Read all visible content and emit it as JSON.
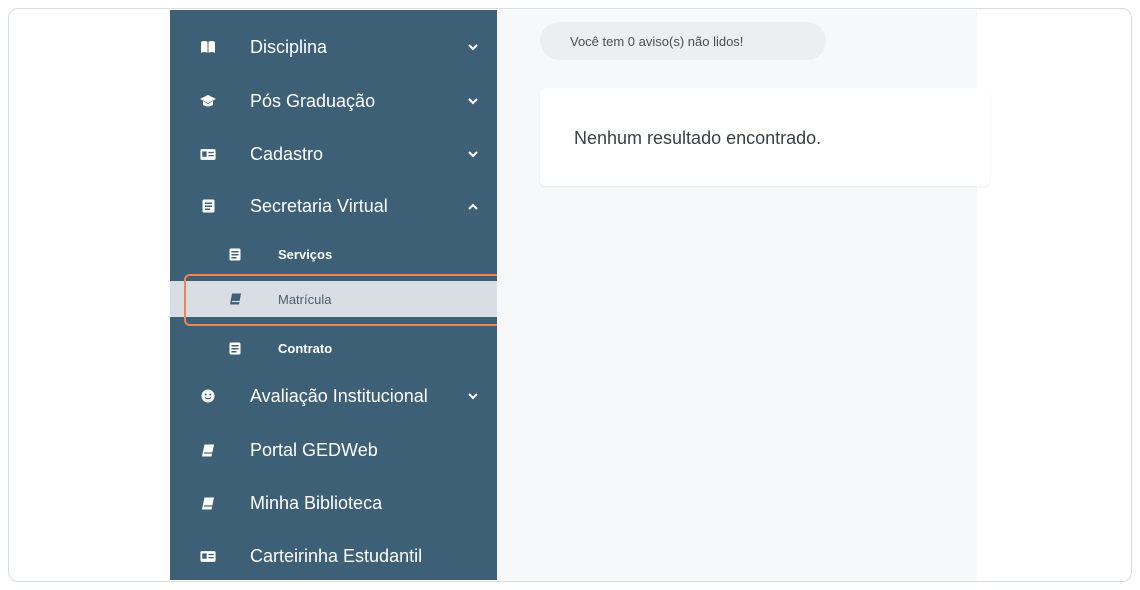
{
  "sidebar": {
    "items": [
      {
        "label": "Disciplina",
        "icon": "book-open-icon",
        "chevron": "chevron-down"
      },
      {
        "label": "Pós Graduação",
        "icon": "graduation-cap-icon",
        "chevron": "chevron-down"
      },
      {
        "label": "Cadastro",
        "icon": "id-card-icon",
        "chevron": "chevron-down"
      },
      {
        "label": "Secretaria Virtual",
        "icon": "document-icon",
        "chevron": "chevron-up"
      },
      {
        "label": "Avaliação Institucional",
        "icon": "smiley-icon",
        "chevron": "chevron-down"
      },
      {
        "label": "Portal GEDWeb",
        "icon": "book-icon"
      },
      {
        "label": "Minha Biblioteca",
        "icon": "book-icon"
      },
      {
        "label": "Carteirinha Estudantil",
        "icon": "id-card-icon"
      }
    ],
    "submenu": [
      {
        "label": "Serviços",
        "icon": "document-icon"
      },
      {
        "label": "Matrícula",
        "icon": "book-icon",
        "active": true
      },
      {
        "label": "Contrato",
        "icon": "document-icon"
      }
    ]
  },
  "main": {
    "notice": "Você tem 0 aviso(s) não lidos!",
    "result_message": "Nenhum resultado encontrado."
  },
  "colors": {
    "sidebar_bg": "#3d6077",
    "active_item_bg": "#d8dee4",
    "highlight_border": "#f0854f",
    "content_bg": "#f7f8f9"
  }
}
